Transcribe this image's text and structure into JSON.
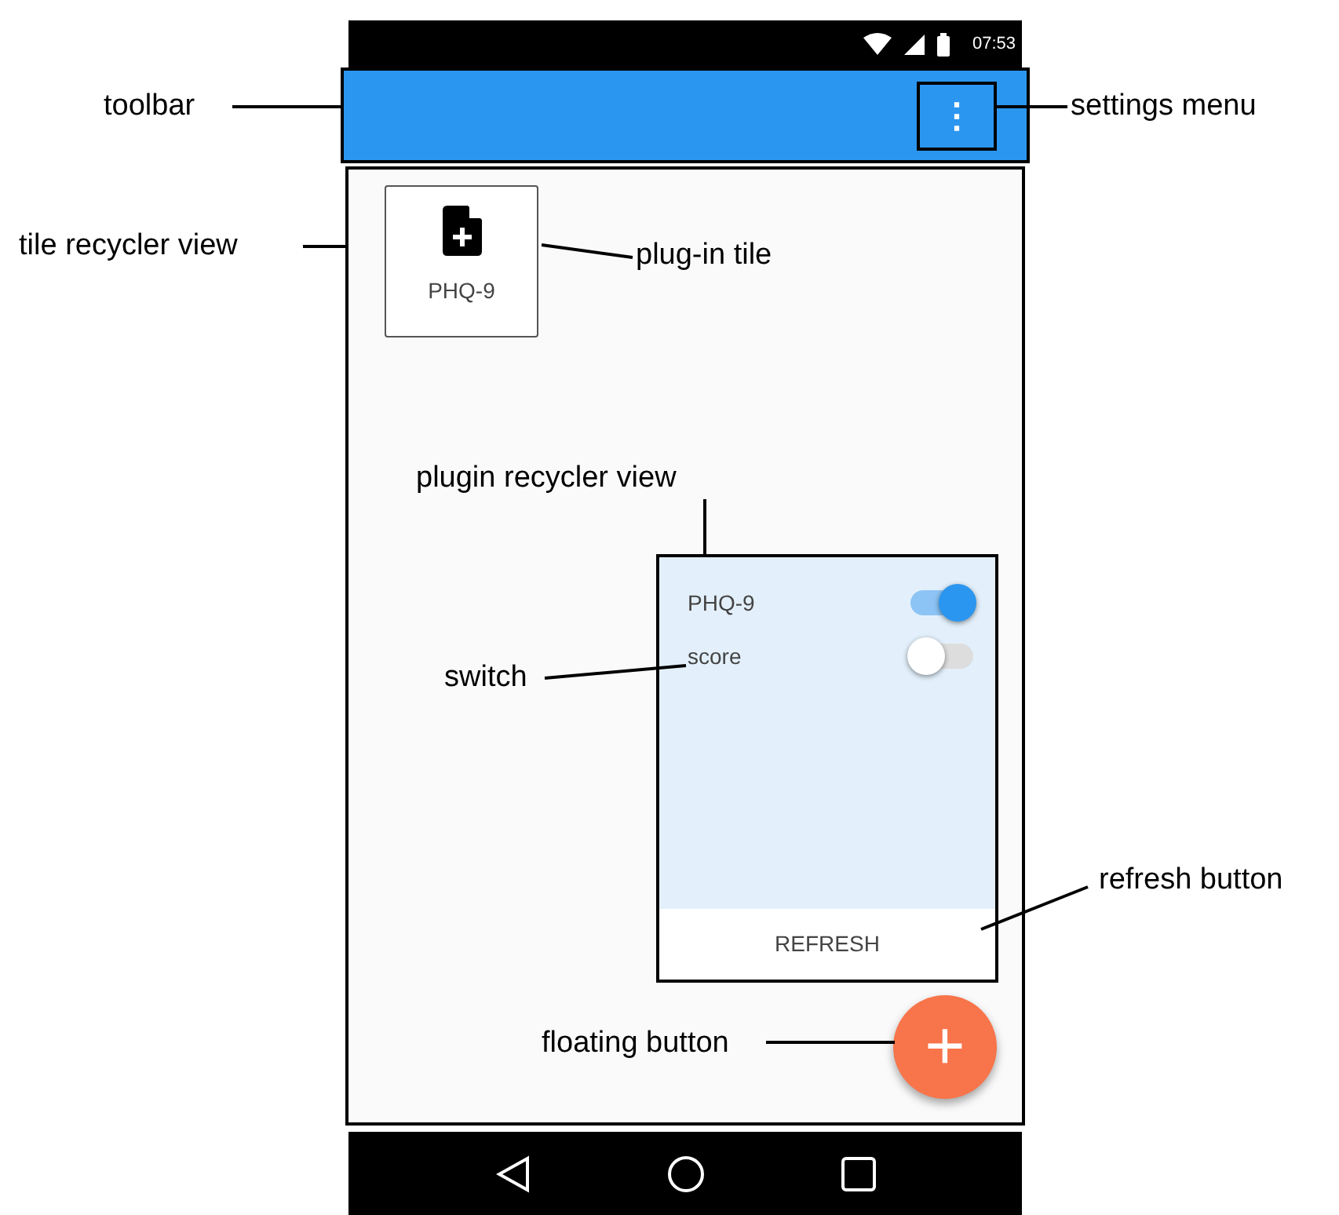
{
  "status_bar": {
    "time": "07:53"
  },
  "toolbar": {
    "menu_icon": "⋮"
  },
  "tiles": [
    {
      "label": "PHQ-9"
    }
  ],
  "plugin_card": {
    "items": [
      {
        "label": "PHQ-9",
        "on": true
      },
      {
        "label": "score",
        "on": false
      }
    ],
    "button": "REFRESH"
  },
  "fab": {
    "label": "+"
  },
  "annotations": [
    {
      "text": "toolbar"
    },
    {
      "text": "settings menu"
    },
    {
      "text": "tile recycler view"
    },
    {
      "text": "plug-in tile"
    },
    {
      "text": "plugin recycler view"
    },
    {
      "text": "switch"
    },
    {
      "text": "refresh button"
    },
    {
      "text": "floating button"
    }
  ]
}
